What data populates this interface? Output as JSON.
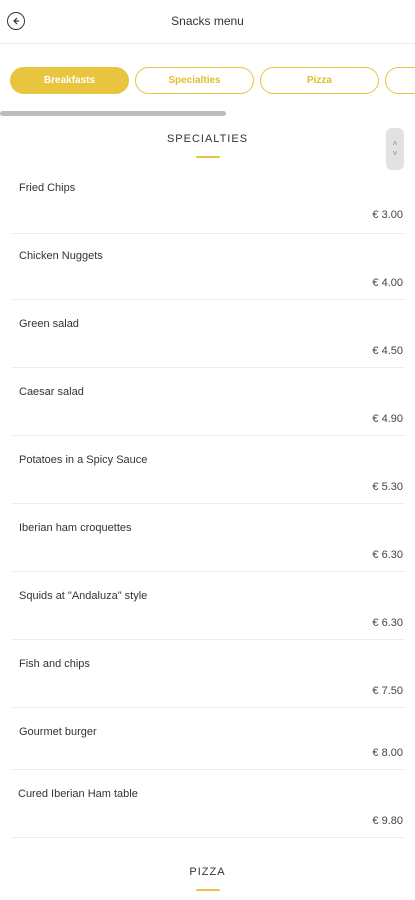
{
  "header": {
    "title": "Snacks menu",
    "back_icon": "back-arrow-icon"
  },
  "tabs": [
    {
      "label": "Breakfasts",
      "active": true
    },
    {
      "label": "Specialties",
      "active": false
    },
    {
      "label": "Pizza",
      "active": false
    },
    {
      "label": "",
      "active": false
    }
  ],
  "sections": [
    {
      "title": "SPECIALTIES"
    },
    {
      "title": "PIZZA"
    }
  ],
  "items": [
    {
      "name": "Fried Chips",
      "price": "€ 3.00"
    },
    {
      "name": "Chicken Nuggets",
      "price": "€ 4.00"
    },
    {
      "name": "Green salad",
      "price": "€ 4.50"
    },
    {
      "name": "Caesar salad",
      "price": "€ 4.90"
    },
    {
      "name": "Potatoes in a Spicy Sauce",
      "price": "€ 5.30"
    },
    {
      "name": "Iberian ham croquettes",
      "price": "€ 6.30"
    },
    {
      "name": "Squids at \"Andaluza\" style",
      "price": "€ 6.30"
    },
    {
      "name": "Fish and chips",
      "price": "€ 7.50"
    },
    {
      "name": "Gourmet burger",
      "price": "€ 8.00"
    },
    {
      "name": "Cured Iberian Ham table",
      "price": "€ 9.80"
    }
  ],
  "colors": {
    "accent": "#e8c43f",
    "text": "#333333",
    "divider": "#ededed"
  }
}
